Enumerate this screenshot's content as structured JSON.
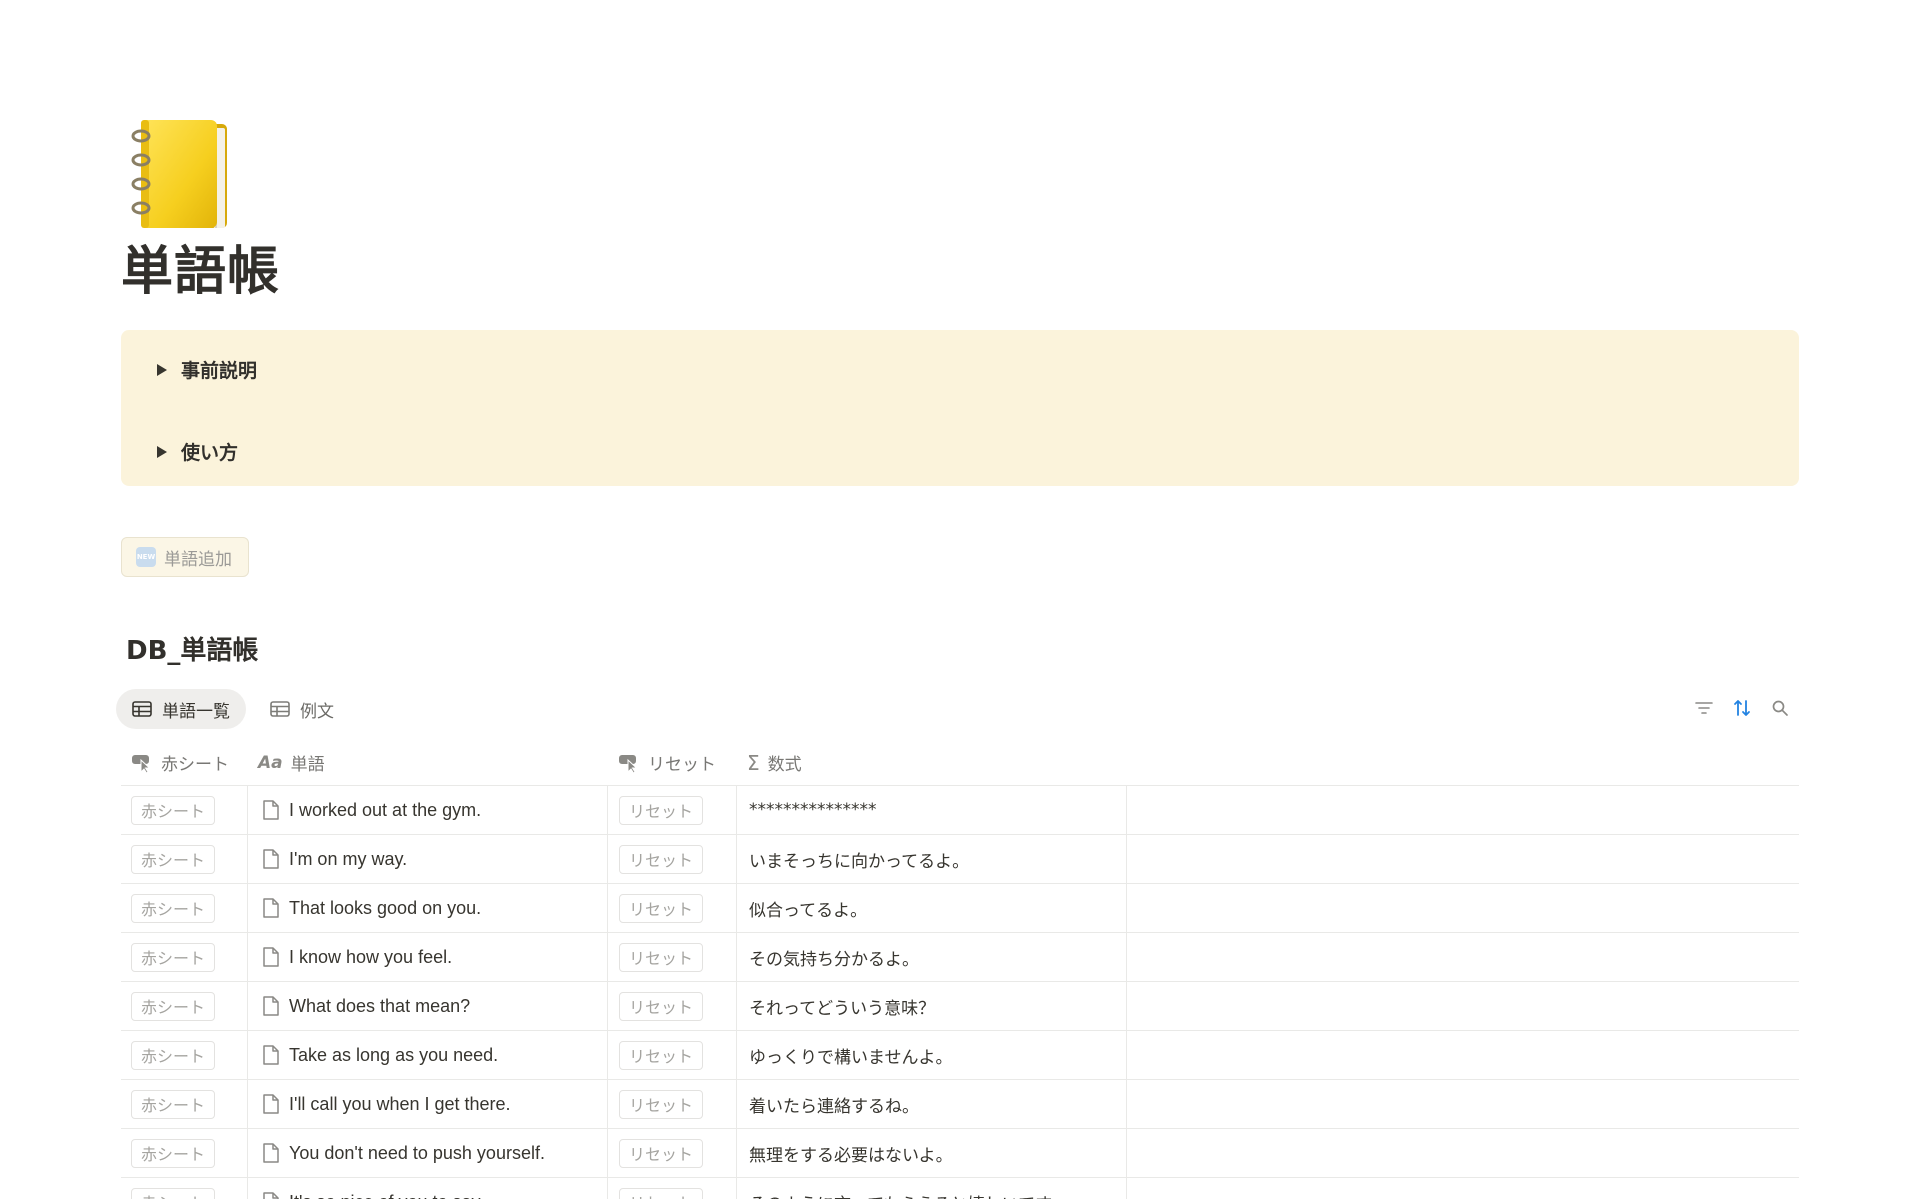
{
  "page": {
    "icon": "spiral-notebook-icon",
    "title": "単語帳"
  },
  "callout": {
    "toggles": [
      {
        "label": "事前説明"
      },
      {
        "label": "使い方"
      }
    ]
  },
  "add_button": {
    "badge": "NEW",
    "label": "単語追加"
  },
  "database": {
    "title": "DB_単語帳",
    "tabs": [
      {
        "label": "単語一覧",
        "icon": "table-icon",
        "active": true
      },
      {
        "label": "例文",
        "icon": "table-icon",
        "active": false
      }
    ],
    "tools": [
      "filter-icon",
      "sort-icon",
      "search-icon"
    ],
    "columns": [
      {
        "label": "赤シート",
        "icon": "button-property-icon"
      },
      {
        "label": "単語",
        "icon": "title-property-icon"
      },
      {
        "label": "リセット",
        "icon": "button-property-icon"
      },
      {
        "label": "数式",
        "icon": "formula-icon"
      }
    ],
    "button_labels": {
      "red_sheet": "赤シート",
      "reset": "リセット"
    },
    "rows": [
      {
        "word": "I worked out at the gym.",
        "formula": "***************"
      },
      {
        "word": "I'm on my way.",
        "formula": "いまそっちに向かってるよ。"
      },
      {
        "word": "That looks good on you.",
        "formula": "似合ってるよ。"
      },
      {
        "word": "I know how you feel.",
        "formula": "その気持ち分かるよ。"
      },
      {
        "word": "What does that mean?",
        "formula": "それってどういう意味？"
      },
      {
        "word": "Take as long as you need.",
        "formula": "ゆっくりで構いませんよ。"
      },
      {
        "word": "I'll call you when I get there.",
        "formula": "着いたら連絡するね。"
      },
      {
        "word": "You don't need to push yourself.",
        "formula": "無理をする必要はないよ。"
      },
      {
        "word": "It's so nice of you to say.",
        "formula": "そのように言ってもらえると嬉しいです。"
      }
    ]
  },
  "colors": {
    "callout_bg": "#fbf3db",
    "text": "#37352f",
    "muted": "#787774",
    "accent": "#2383e2"
  }
}
